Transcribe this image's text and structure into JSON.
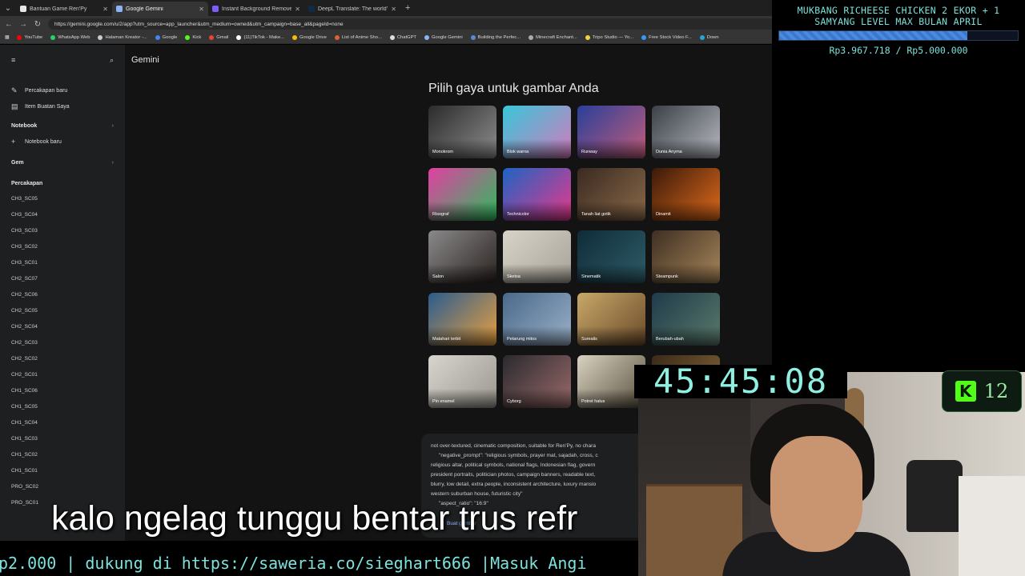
{
  "browser": {
    "tabs": [
      {
        "title": "Bantuan Game Ren'Py",
        "color": "#e8e8e8",
        "active": false
      },
      {
        "title": "Google Gemini",
        "color": "#8ab4f8",
        "active": true
      },
      {
        "title": "Instant Background Remover - Re",
        "color": "#7c5cff",
        "active": false
      },
      {
        "title": "DeepL Translate: The world's mos",
        "color": "#0f2b46",
        "active": false
      }
    ],
    "url": "https://gemini.google.com/u/2/app?utm_source=app_launcher&utm_medium=owned&utm_campaign=base_all&pageId=none",
    "bookmarks": [
      {
        "label": "YouTube",
        "color": "#ff0000"
      },
      {
        "label": "WhatsApp Web",
        "color": "#25d366"
      },
      {
        "label": "Halaman Kreator -...",
        "color": "#cccccc"
      },
      {
        "label": "Google",
        "color": "#4285f4"
      },
      {
        "label": "Kick",
        "color": "#53fc18"
      },
      {
        "label": "Gmail",
        "color": "#ea4335"
      },
      {
        "label": "(11)TikTok - Make...",
        "color": "#ffffff"
      },
      {
        "label": "Google Drive",
        "color": "#fbbc04"
      },
      {
        "label": "List of Anime Sho...",
        "color": "#e06030"
      },
      {
        "label": "ChatGPT",
        "color": "#dddddd"
      },
      {
        "label": "Google Gemini",
        "color": "#8ab4f8"
      },
      {
        "label": "Building the Perfec...",
        "color": "#5a8ad6"
      },
      {
        "label": "Minecraft Enchant...",
        "color": "#aaaaaa"
      },
      {
        "label": "Tripo Studio — Yo...",
        "color": "#f4d03f"
      },
      {
        "label": "Free Stock Video F...",
        "color": "#3399ff"
      },
      {
        "label": "Down",
        "color": "#29a3d8"
      }
    ]
  },
  "gemini": {
    "app_title": "Gemini",
    "sidebar": {
      "new_chat": "Percakapan baru",
      "my_stuff": "Item Buatan Saya",
      "notebook_head": "Notebook",
      "new_notebook": "Notebook baru",
      "gem_head": "Gem",
      "chats_head": "Percakapan",
      "chats": [
        "CH3_SC05",
        "CH3_SC04",
        "CH3_SC03",
        "CH3_SC02",
        "CH3_SC01",
        "CH2_SC07",
        "CH2_SC06",
        "CH2_SC05",
        "CH2_SC04",
        "CH2_SC03",
        "CH2_SC02",
        "CH2_SC01",
        "CH1_SC06",
        "CH1_SC05",
        "CH1_SC04",
        "CH1_SC03",
        "CH1_SC02",
        "CH1_SC01",
        "PRO_SC02",
        "PRO_SC01"
      ]
    },
    "style_heading": "Pilih gaya untuk gambar Anda",
    "styles": [
      {
        "label": "Monokrom",
        "c1": "#2b2b2b",
        "c2": "#8d8d8d"
      },
      {
        "label": "Blok warna",
        "c1": "#38c6d9",
        "c2": "#d27bbd"
      },
      {
        "label": "Runway",
        "c1": "#2a3f9a",
        "c2": "#c25d7a"
      },
      {
        "label": "Dunia Anyma",
        "c1": "#3b3f46",
        "c2": "#b8bcc2"
      },
      {
        "label": "Risograf",
        "c1": "#e23ea3",
        "c2": "#2bbf5c"
      },
      {
        "label": "Technicolor",
        "c1": "#1d64c4",
        "c2": "#e8388a"
      },
      {
        "label": "Tanah liat gotik",
        "c1": "#3a2a22",
        "c2": "#8a6a48"
      },
      {
        "label": "Dinamit",
        "c1": "#3a1a0a",
        "c2": "#e06a1a"
      },
      {
        "label": "Salon",
        "c1": "#8a8a8a",
        "c2": "#2a2220"
      },
      {
        "label": "Sketsa",
        "c1": "#d8d3c8",
        "c2": "#a8a398"
      },
      {
        "label": "Sinematik",
        "c1": "#0f2c38",
        "c2": "#2e5c68"
      },
      {
        "label": "Steampunk",
        "c1": "#3e2f22",
        "c2": "#a8865a"
      },
      {
        "label": "Matahari terbit",
        "c1": "#2b5c8e",
        "c2": "#e8a040"
      },
      {
        "label": "Petarung mitos",
        "c1": "#4a6a8a",
        "c2": "#9ab0c8"
      },
      {
        "label": "Surealis",
        "c1": "#c8a868",
        "c2": "#6a4a2a"
      },
      {
        "label": "Berubah-ubah",
        "c1": "#1f3a4a",
        "c2": "#5a7a6a"
      },
      {
        "label": "Pin enamel",
        "c1": "#d8d4ce",
        "c2": "#9a9690"
      },
      {
        "label": "Cyborg",
        "c1": "#2a2a2e",
        "c2": "#9a6a6a"
      },
      {
        "label": "Potret halus",
        "c1": "#d8d2c0",
        "c2": "#5a5040"
      },
      {
        "label": "",
        "c1": "#3a2a1a",
        "c2": "#8a6a3a"
      }
    ],
    "prompt_lines": [
      "not over-textured, cinematic composition, suitable for Ren'Py, no chara",
      "\"negative_prompt\": \"religious symbols, prayer mat, sajadah, cross, c",
      "religious altar, political symbols, national flags, Indonesian flag, govern",
      "president portraits, politician photos, campaign banners, readable text,",
      "blurry, low detail, extra people, inconsistent architecture, luxury mansio",
      "western suburban house, futuristic city\"",
      "\"aspect_ratio\": \"16:9\""
    ],
    "prompt_link": "Buat gambar"
  },
  "overlay": {
    "goal_line1": "MUKBANG RICHEESE CHICKEN 2 EKOR + 1",
    "goal_line2": "SAMYANG LEVEL MAX BULAN APRIL",
    "goal_amount": "Rp3.967.718 / Rp5.000.000",
    "goal_progress": 0.79,
    "timer": "45:45:08",
    "kick_count": "12",
    "subtitle": "kalo ngelag tunggu bentar trus refr",
    "ticker": "p2.000 |  dukung di https://saweria.co/sieghart666 |Masuk Angi"
  }
}
